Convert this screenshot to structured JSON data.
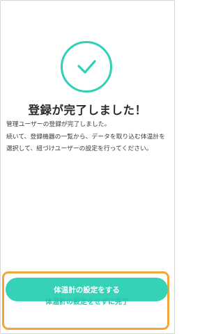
{
  "completion": {
    "icon": "checkmark-icon",
    "title": "登録が完了しました！",
    "message_line1": "管理ユーザーの登録が完了しました。",
    "message_line2": "続いて、登録機器の一覧から、データを取り込む体温計を選択して、紐づけユーザーの設定を行ってください。"
  },
  "actions": {
    "primary_label": "体温計の設定をする",
    "skip_label": "体温計の設定をせずに完了"
  },
  "colors": {
    "accent": "#35d2b8",
    "highlight_border": "#f0a63a"
  }
}
